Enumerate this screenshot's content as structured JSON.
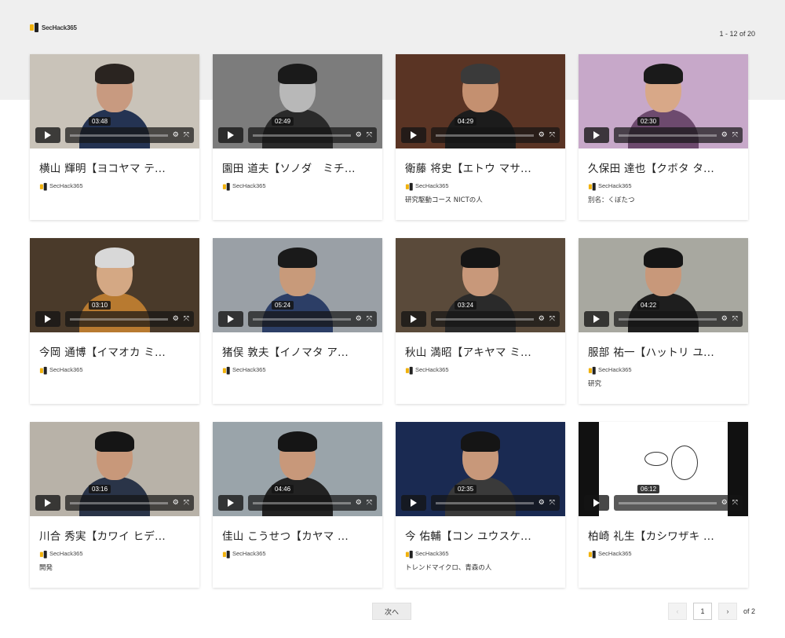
{
  "header": {
    "logo_text": "SecHack365",
    "range_text": "1 - 12 of 20"
  },
  "colors": {
    "accent": "#f1b20c",
    "band": "#efefef"
  },
  "videos": [
    {
      "title": "横山 輝明【ヨコヤマ テ...",
      "duration": "03:48",
      "channel": "SecHack365",
      "desc": "",
      "bg": "#c9c3b9",
      "hair": "#2a2420",
      "skin": "#c89a80",
      "body": "#243352"
    },
    {
      "title": "園田 道夫【ソノダ　ミチ...",
      "duration": "02:49",
      "channel": "SecHack365",
      "desc": "",
      "bg": "#7c7c7c",
      "hair": "#1a1a1a",
      "skin": "#b8b8b8",
      "body": "#2a2a2a"
    },
    {
      "title": "衛藤 将史【エトウ マサ...",
      "duration": "04:29",
      "channel": "SecHack365",
      "desc": "研究駆動コース NICTの人",
      "bg": "#5a3424",
      "hair": "#3a3a3a",
      "skin": "#c49070",
      "body": "#1c1c1c"
    },
    {
      "title": "久保田 達也【クボタ タ...",
      "duration": "02:30",
      "channel": "SecHack365",
      "desc": "別名：くぼたつ",
      "bg": "#c7a8c9",
      "hair": "#1a1a1a",
      "skin": "#d8a888",
      "body": "#6d4a6e"
    },
    {
      "title": "今岡 通博【イマオカ ミ...",
      "duration": "03:10",
      "channel": "SecHack365",
      "desc": "",
      "bg": "#4a3a2a",
      "hair": "#d8d8d8",
      "skin": "#d4a884",
      "body": "#b87a30"
    },
    {
      "title": "猪俣 敦夫【イノマタ ア...",
      "duration": "05:24",
      "channel": "SecHack365",
      "desc": "",
      "bg": "#9aa0a6",
      "hair": "#1a1a1a",
      "skin": "#c89a7a",
      "body": "#2c3e66"
    },
    {
      "title": "秋山 満昭【アキヤマ ミ...",
      "duration": "03:24",
      "channel": "SecHack365",
      "desc": "",
      "bg": "#5a4a3a",
      "hair": "#151515",
      "skin": "#c8987a",
      "body": "#2a2a2a"
    },
    {
      "title": "服部 祐一【ハットリ ユ...",
      "duration": "04:22",
      "channel": "SecHack365",
      "desc": "研究",
      "bg": "#a8a8a0",
      "hair": "#151515",
      "skin": "#c8987a",
      "body": "#1e1e1e"
    },
    {
      "title": "川合 秀実【カワイ ヒデ...",
      "duration": "03:16",
      "channel": "SecHack365",
      "desc": "開発",
      "bg": "#b8b2a8",
      "hair": "#151515",
      "skin": "#c8987a",
      "body": "#2a3448"
    },
    {
      "title": "佳山 こうせつ【カヤマ ...",
      "duration": "04:46",
      "channel": "SecHack365",
      "desc": "",
      "bg": "#9aa4aa",
      "hair": "#151515",
      "skin": "#c8987a",
      "body": "#222222"
    },
    {
      "title": "今 佑輔【コン ユウスケ...",
      "duration": "02:35",
      "channel": "SecHack365",
      "desc": "トレンドマイクロ、青森の人",
      "bg": "#1a2a52",
      "hair": "#151515",
      "skin": "#c8987a",
      "body": "#3a3a3a"
    },
    {
      "title": "柏崎 礼生【カシワザキ ...",
      "duration": "06:12",
      "channel": "SecHack365",
      "desc": "",
      "bg": "#f2f2f2",
      "hair": "#ffffff",
      "skin": "#ffffff",
      "body": "#ffffff"
    }
  ],
  "footer": {
    "next_label": "次へ",
    "prev_icon": "‹",
    "next_icon": "›",
    "page_value": "1",
    "of_pages": "of 2"
  }
}
